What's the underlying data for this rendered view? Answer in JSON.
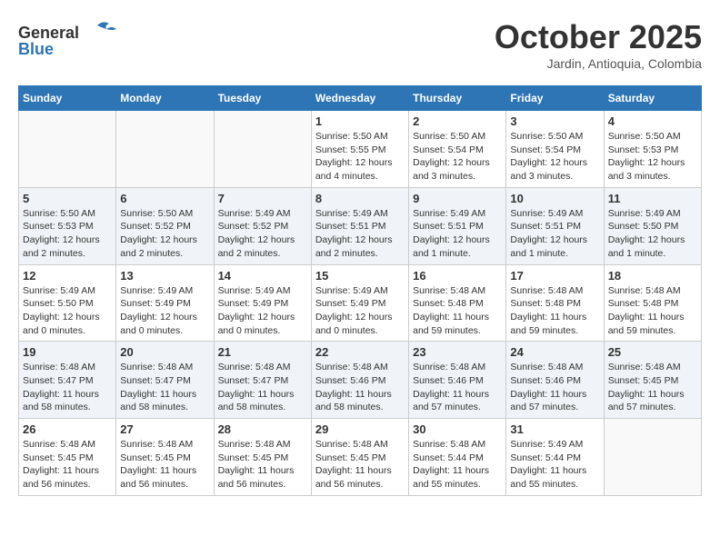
{
  "header": {
    "logo_line1": "General",
    "logo_line2": "Blue",
    "month": "October 2025",
    "location": "Jardin, Antioquia, Colombia"
  },
  "weekdays": [
    "Sunday",
    "Monday",
    "Tuesday",
    "Wednesday",
    "Thursday",
    "Friday",
    "Saturday"
  ],
  "weeks": [
    [
      {
        "day": "",
        "info": ""
      },
      {
        "day": "",
        "info": ""
      },
      {
        "day": "",
        "info": ""
      },
      {
        "day": "1",
        "info": "Sunrise: 5:50 AM\nSunset: 5:55 PM\nDaylight: 12 hours\nand 4 minutes."
      },
      {
        "day": "2",
        "info": "Sunrise: 5:50 AM\nSunset: 5:54 PM\nDaylight: 12 hours\nand 3 minutes."
      },
      {
        "day": "3",
        "info": "Sunrise: 5:50 AM\nSunset: 5:54 PM\nDaylight: 12 hours\nand 3 minutes."
      },
      {
        "day": "4",
        "info": "Sunrise: 5:50 AM\nSunset: 5:53 PM\nDaylight: 12 hours\nand 3 minutes."
      }
    ],
    [
      {
        "day": "5",
        "info": "Sunrise: 5:50 AM\nSunset: 5:53 PM\nDaylight: 12 hours\nand 2 minutes."
      },
      {
        "day": "6",
        "info": "Sunrise: 5:50 AM\nSunset: 5:52 PM\nDaylight: 12 hours\nand 2 minutes."
      },
      {
        "day": "7",
        "info": "Sunrise: 5:49 AM\nSunset: 5:52 PM\nDaylight: 12 hours\nand 2 minutes."
      },
      {
        "day": "8",
        "info": "Sunrise: 5:49 AM\nSunset: 5:51 PM\nDaylight: 12 hours\nand 2 minutes."
      },
      {
        "day": "9",
        "info": "Sunrise: 5:49 AM\nSunset: 5:51 PM\nDaylight: 12 hours\nand 1 minute."
      },
      {
        "day": "10",
        "info": "Sunrise: 5:49 AM\nSunset: 5:51 PM\nDaylight: 12 hours\nand 1 minute."
      },
      {
        "day": "11",
        "info": "Sunrise: 5:49 AM\nSunset: 5:50 PM\nDaylight: 12 hours\nand 1 minute."
      }
    ],
    [
      {
        "day": "12",
        "info": "Sunrise: 5:49 AM\nSunset: 5:50 PM\nDaylight: 12 hours\nand 0 minutes."
      },
      {
        "day": "13",
        "info": "Sunrise: 5:49 AM\nSunset: 5:49 PM\nDaylight: 12 hours\nand 0 minutes."
      },
      {
        "day": "14",
        "info": "Sunrise: 5:49 AM\nSunset: 5:49 PM\nDaylight: 12 hours\nand 0 minutes."
      },
      {
        "day": "15",
        "info": "Sunrise: 5:49 AM\nSunset: 5:49 PM\nDaylight: 12 hours\nand 0 minutes."
      },
      {
        "day": "16",
        "info": "Sunrise: 5:48 AM\nSunset: 5:48 PM\nDaylight: 11 hours\nand 59 minutes."
      },
      {
        "day": "17",
        "info": "Sunrise: 5:48 AM\nSunset: 5:48 PM\nDaylight: 11 hours\nand 59 minutes."
      },
      {
        "day": "18",
        "info": "Sunrise: 5:48 AM\nSunset: 5:48 PM\nDaylight: 11 hours\nand 59 minutes."
      }
    ],
    [
      {
        "day": "19",
        "info": "Sunrise: 5:48 AM\nSunset: 5:47 PM\nDaylight: 11 hours\nand 58 minutes."
      },
      {
        "day": "20",
        "info": "Sunrise: 5:48 AM\nSunset: 5:47 PM\nDaylight: 11 hours\nand 58 minutes."
      },
      {
        "day": "21",
        "info": "Sunrise: 5:48 AM\nSunset: 5:47 PM\nDaylight: 11 hours\nand 58 minutes."
      },
      {
        "day": "22",
        "info": "Sunrise: 5:48 AM\nSunset: 5:46 PM\nDaylight: 11 hours\nand 58 minutes."
      },
      {
        "day": "23",
        "info": "Sunrise: 5:48 AM\nSunset: 5:46 PM\nDaylight: 11 hours\nand 57 minutes."
      },
      {
        "day": "24",
        "info": "Sunrise: 5:48 AM\nSunset: 5:46 PM\nDaylight: 11 hours\nand 57 minutes."
      },
      {
        "day": "25",
        "info": "Sunrise: 5:48 AM\nSunset: 5:45 PM\nDaylight: 11 hours\nand 57 minutes."
      }
    ],
    [
      {
        "day": "26",
        "info": "Sunrise: 5:48 AM\nSunset: 5:45 PM\nDaylight: 11 hours\nand 56 minutes."
      },
      {
        "day": "27",
        "info": "Sunrise: 5:48 AM\nSunset: 5:45 PM\nDaylight: 11 hours\nand 56 minutes."
      },
      {
        "day": "28",
        "info": "Sunrise: 5:48 AM\nSunset: 5:45 PM\nDaylight: 11 hours\nand 56 minutes."
      },
      {
        "day": "29",
        "info": "Sunrise: 5:48 AM\nSunset: 5:45 PM\nDaylight: 11 hours\nand 56 minutes."
      },
      {
        "day": "30",
        "info": "Sunrise: 5:48 AM\nSunset: 5:44 PM\nDaylight: 11 hours\nand 55 minutes."
      },
      {
        "day": "31",
        "info": "Sunrise: 5:49 AM\nSunset: 5:44 PM\nDaylight: 11 hours\nand 55 minutes."
      },
      {
        "day": "",
        "info": ""
      }
    ]
  ]
}
